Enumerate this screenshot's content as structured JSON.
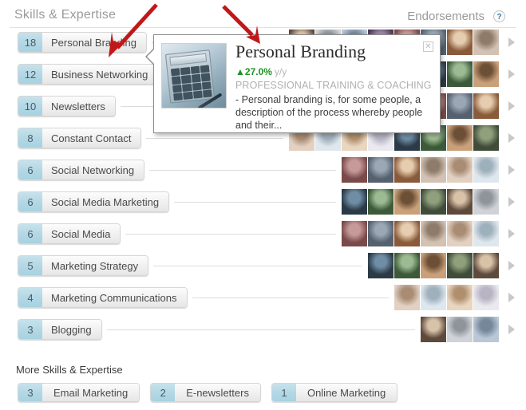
{
  "header": {
    "title": "Skills & Expertise",
    "endorsements_label": "Endorsements",
    "help_icon": "question-mark-icon",
    "help_glyph": "?"
  },
  "skills": [
    {
      "count": "18",
      "label": "Personal Branding",
      "avatars": 8,
      "selected": true
    },
    {
      "count": "12",
      "label": "Business Networking",
      "avatars": 7,
      "selected": false
    },
    {
      "count": "10",
      "label": "Newsletters",
      "avatars": 7,
      "selected": false
    },
    {
      "count": "8",
      "label": "Constant Contact",
      "avatars": 8,
      "selected": false
    },
    {
      "count": "6",
      "label": "Social Networking",
      "avatars": 6,
      "selected": false
    },
    {
      "count": "6",
      "label": "Social Media Marketing",
      "avatars": 6,
      "selected": false
    },
    {
      "count": "6",
      "label": "Social Media",
      "avatars": 6,
      "selected": false
    },
    {
      "count": "5",
      "label": "Marketing Strategy",
      "avatars": 5,
      "selected": false
    },
    {
      "count": "4",
      "label": "Marketing Communications",
      "avatars": 4,
      "selected": false
    },
    {
      "count": "3",
      "label": "Blogging",
      "avatars": 3,
      "selected": false
    }
  ],
  "more": {
    "title": "More Skills & Expertise",
    "pills": [
      {
        "count": "3",
        "label": "Email Marketing"
      },
      {
        "count": "2",
        "label": "E-newsletters"
      },
      {
        "count": "1",
        "label": "Online Marketing"
      }
    ]
  },
  "tooltip": {
    "title": "Personal Branding",
    "trend_arrow": "▲",
    "trend_value": "27.0%",
    "trend_period": "y/y",
    "category": "PROFESSIONAL TRAINING & COACHING",
    "description": "- Personal branding is, for some people, a description of the process whereby people and their...",
    "close_glyph": "✕",
    "thumbnail": "calculator-photo"
  },
  "colors": {
    "badge_blue": "#b2d7e5",
    "label_gray": "#f0f0f0",
    "trend_green": "#1d9321",
    "help_blue": "#2f7fb5",
    "annotation_red": "#c0181a"
  },
  "annotations": [
    {
      "name": "arrow-to-personal-branding-pill"
    },
    {
      "name": "arrow-to-tooltip-title"
    }
  ]
}
